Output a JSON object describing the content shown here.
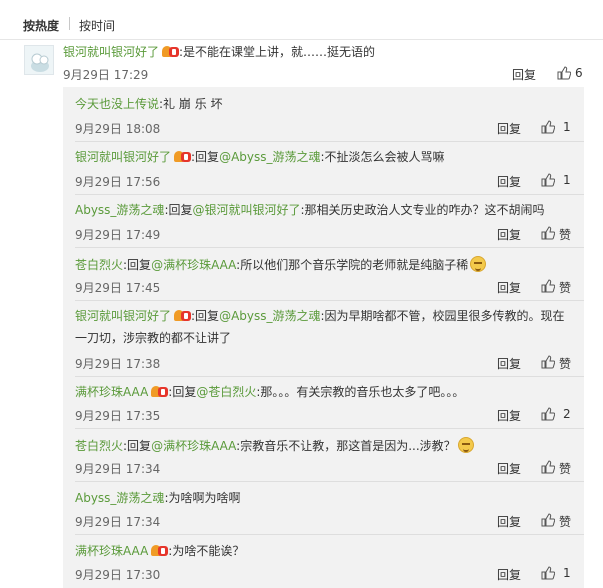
{
  "sort": {
    "hot": "按热度",
    "time": "按时间"
  },
  "root": {
    "user": "银河就叫银河好了",
    "text": ":是不能在课堂上讲，就……挺无语的",
    "time": "9月29日 17:29",
    "reply": "回复",
    "likes": "6"
  },
  "replies": [
    {
      "user": "今天也没上传说",
      "parts": [
        ":礼 崩 乐 坏"
      ],
      "time": "9月29日 18:08",
      "reply": "回复",
      "likes": "1"
    },
    {
      "user": "银河就叫银河好了",
      "parts": [
        ":回复",
        "@Abyss_游荡之魂",
        ":不扯淡怎么会被人骂嘛"
      ],
      "time": "9月29日 17:56",
      "reply": "回复",
      "likes": "1"
    },
    {
      "user": "Abyss_游荡之魂",
      "parts": [
        ":回复",
        "@银河就叫银河好了",
        ":那相关历史政治人文专业的咋办？这不胡闹吗"
      ],
      "time": "9月29日 17:49",
      "reply": "回复",
      "likes": "赞"
    },
    {
      "user": "苍白烈火",
      "parts": [
        ":回复",
        "@满杯珍珠AAA",
        ":所以他们那个音乐学院的老师就是纯脑子稀"
      ],
      "time": "9月29日 17:45",
      "reply": "回复",
      "likes": "赞"
    },
    {
      "user": "银河就叫银河好了",
      "parts": [
        ":回复",
        "@Abyss_游荡之魂",
        ":因为早期啥都不管，校园里很多传教的。现在一刀切，涉宗教的都不让讲了"
      ],
      "time": "9月29日 17:38",
      "reply": "回复",
      "likes": "赞"
    },
    {
      "user": "满杯珍珠AAA",
      "parts": [
        ":回复",
        "@苍白烈火",
        ":那。。。有关宗教的音乐也太多了吧。。。"
      ],
      "time": "9月29日 17:35",
      "reply": "回复",
      "likes": "2"
    },
    {
      "user": "苍白烈火",
      "parts": [
        ":回复",
        "@满杯珍珠AAA",
        ":宗教音乐不让教，那这首是因为...涉教？"
      ],
      "time": "9月29日 17:34",
      "reply": "回复",
      "likes": "赞"
    },
    {
      "user": "Abyss_游荡之魂",
      "parts": [
        ":为啥啊为啥啊"
      ],
      "time": "9月29日 17:34",
      "reply": "回复",
      "likes": "赞"
    },
    {
      "user": "满杯珍珠AAA",
      "parts": [
        ":为啥不能诶？"
      ],
      "time": "9月29日 17:30",
      "reply": "回复",
      "likes": "1"
    }
  ]
}
